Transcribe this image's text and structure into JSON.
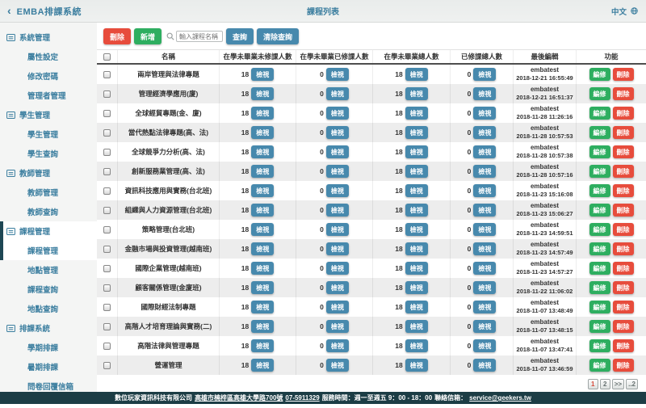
{
  "topbar": {
    "app_title": "EMBA排課系統",
    "page_title": "課程列表",
    "lang_label": "中文",
    "back_icon": "‹"
  },
  "sidebar": {
    "sections": [
      {
        "label": "系統管理",
        "children": [
          "屬性設定",
          "修改密碼",
          "管理者管理"
        ]
      },
      {
        "label": "學生管理",
        "children": [
          "學生管理",
          "學生查詢"
        ]
      },
      {
        "label": "教師管理",
        "children": [
          "教師管理",
          "教師查詢"
        ]
      },
      {
        "label": "課程管理",
        "children": [
          "課程管理",
          "地點管理",
          "課程查詢",
          "地點查詢"
        ],
        "active_child": "課程管理"
      },
      {
        "label": "排課系統",
        "children": [
          "學期排課",
          "暑期排課",
          "問卷回覆信箱"
        ]
      }
    ]
  },
  "toolbar": {
    "delete_label": "刪除",
    "add_label": "新增",
    "search_placeholder": "輸入課程名稱",
    "search_value": "",
    "search_label": "查詢",
    "clear_label": "清除查詢"
  },
  "table": {
    "headers": [
      "名稱",
      "在學未畢業未修課人數",
      "在學未畢業已修課人數",
      "在學未畢業總人數",
      "已修課總人數",
      "最後編輯",
      "功能"
    ],
    "view_label": "檢視",
    "edit_label": "編修",
    "delete_label": "刪除",
    "rows": [
      {
        "name": "兩岸管理與法律專題",
        "counts": [
          18,
          0,
          18,
          0
        ],
        "editor": "embatest",
        "edited_at": "2018-12-21 16:55:49"
      },
      {
        "name": "管理經濟學應用(廈)",
        "counts": [
          18,
          0,
          18,
          0
        ],
        "editor": "embatest",
        "edited_at": "2018-12-21 16:51:37"
      },
      {
        "name": "全球經貿專題(金、廈)",
        "counts": [
          18,
          0,
          18,
          0
        ],
        "editor": "embatest",
        "edited_at": "2018-11-28 11:26:16"
      },
      {
        "name": "當代熱點法律專題(高、法)",
        "counts": [
          18,
          0,
          18,
          0
        ],
        "editor": "embatest",
        "edited_at": "2018-11-28 10:57:53"
      },
      {
        "name": "全球競爭力分析(高、法)",
        "counts": [
          18,
          0,
          18,
          0
        ],
        "editor": "embatest",
        "edited_at": "2018-11-28 10:57:38"
      },
      {
        "name": "創新服務業管理(高、法)",
        "counts": [
          18,
          0,
          18,
          0
        ],
        "editor": "embatest",
        "edited_at": "2018-11-28 10:57:16"
      },
      {
        "name": "資訊科技應用與實務(台北班)",
        "counts": [
          18,
          0,
          18,
          0
        ],
        "editor": "embatest",
        "edited_at": "2018-11-23 15:16:08"
      },
      {
        "name": "組織與人力資源管理(台北班)",
        "counts": [
          18,
          0,
          18,
          0
        ],
        "editor": "embatest",
        "edited_at": "2018-11-23 15:06:27"
      },
      {
        "name": "策略管理(台北班)",
        "counts": [
          18,
          0,
          18,
          0
        ],
        "editor": "embatest",
        "edited_at": "2018-11-23 14:59:51"
      },
      {
        "name": "金融市場與投資管理(越南班)",
        "counts": [
          18,
          0,
          18,
          0
        ],
        "editor": "embatest",
        "edited_at": "2018-11-23 14:57:49"
      },
      {
        "name": "國際企業管理(越南班)",
        "counts": [
          18,
          0,
          18,
          0
        ],
        "editor": "embatest",
        "edited_at": "2018-11-23 14:57:27"
      },
      {
        "name": "顧客關係管理(金廈班)",
        "counts": [
          18,
          0,
          18,
          0
        ],
        "editor": "embatest",
        "edited_at": "2018-11-22 11:06:02"
      },
      {
        "name": "國際財經法制專題",
        "counts": [
          18,
          0,
          18,
          0
        ],
        "editor": "embatest",
        "edited_at": "2018-11-07 13:48:49"
      },
      {
        "name": "高階人才培育理論與實務(二)",
        "counts": [
          18,
          0,
          18,
          0
        ],
        "editor": "embatest",
        "edited_at": "2018-11-07 13:48:15"
      },
      {
        "name": "高階法律與管理專題",
        "counts": [
          18,
          0,
          18,
          0
        ],
        "editor": "embatest",
        "edited_at": "2018-11-07 13:47:41"
      },
      {
        "name": "營運管理",
        "counts": [
          18,
          0,
          18,
          0
        ],
        "editor": "embatest",
        "edited_at": "2018-11-07 13:46:59"
      }
    ]
  },
  "pagination": {
    "pages": [
      "1",
      "2",
      ">>",
      "..2"
    ],
    "current": "1"
  },
  "footer": {
    "company": "數位玩家資訊科技有限公司",
    "address": "高雄市楠梓區高雄大學路700號",
    "phone": "07-5911329",
    "hours": "服務時間：週一至週五 9：00 - 18：00",
    "contact_label": "聯絡信箱：",
    "email": "service@geekers.tw"
  },
  "colors": {
    "accent_teal": "#3b7e9f",
    "dark_teal": "#1c3d45",
    "danger_red": "#e74c3c",
    "success_green": "#2eae60",
    "info_blue": "#4789ad"
  }
}
